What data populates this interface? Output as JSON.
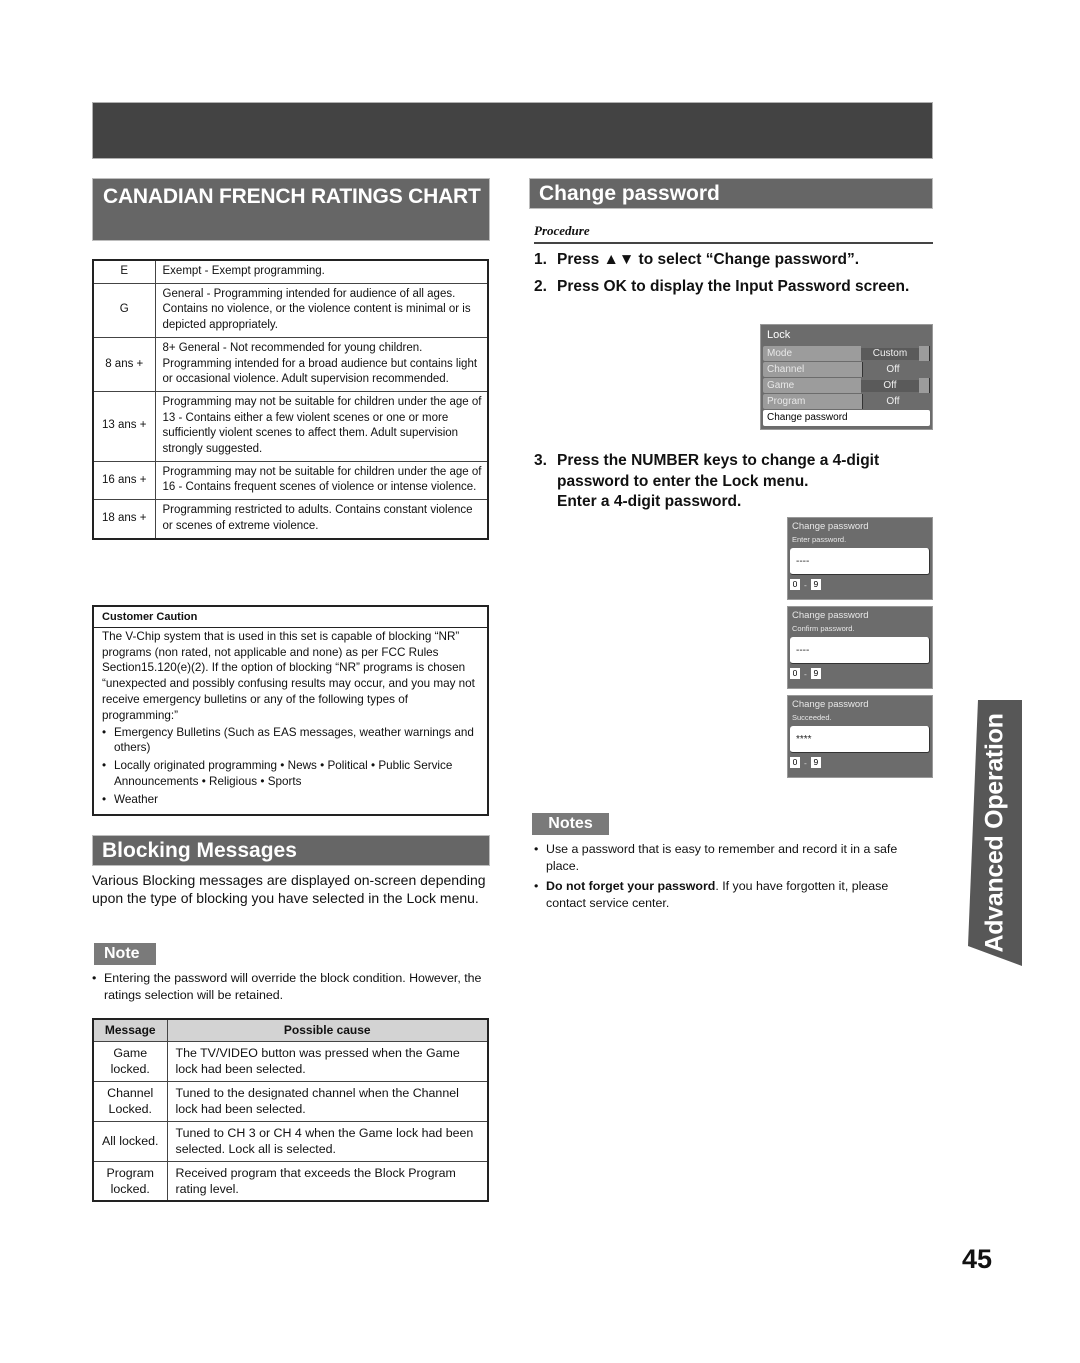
{
  "page_number": "45",
  "side_tab": {
    "label": "Advanced Operation"
  },
  "left": {
    "canadian_header": "CANADIAN FRENCH RATINGS CHART",
    "ratings": [
      {
        "code": "E",
        "description": "Exempt - Exempt programming."
      },
      {
        "code": "G",
        "description": "General - Programming intended for audience of all ages. Contains no violence, or the violence content is minimal or is depicted appropriately."
      },
      {
        "code": "8 ans +",
        "description": "8+ General - Not recommended for young children. Programming intended for a broad audience but contains light or occasional violence. Adult supervision recommended."
      },
      {
        "code": "13 ans +",
        "description": "Programming may not be suitable for children under the age of 13 - Contains either a few violent scenes or one or more sufficiently violent scenes to affect them. Adult supervision strongly suggested."
      },
      {
        "code": "16 ans +",
        "description": "Programming may not be suitable for children under the age of 16 - Contains frequent scenes of violence or intense violence."
      },
      {
        "code": "18 ans +",
        "description": "Programming restricted to adults. Contains constant violence or scenes of extreme violence."
      }
    ],
    "customer_caution": {
      "title": "Customer Caution",
      "body": "The V-Chip system that is used in this set is capable of blocking “NR” programs (non rated, not applicable and none) as per FCC Rules Section15.120(e)(2). If the option of blocking “NR” programs is chosen “unexpected and possibly confusing results may occur, and you may not receive emergency bulletins or any of the following types of programming:”",
      "bullets": [
        "Emergency Bulletins (Such as EAS messages, weather warnings and others)",
        "Locally originated programming • News • Political • Public Service Announcements • Religious • Sports",
        "Weather"
      ]
    },
    "blocking_header": "Blocking Messages",
    "blocking_intro": "Various Blocking messages are displayed on-screen depending upon the type of blocking you have selected in the Lock menu.",
    "note_label": "Note",
    "note_items": [
      "Entering the password will override the block condition. However, the ratings selection will be retained."
    ],
    "messages_table": {
      "headers": [
        "Message",
        "Possible cause"
      ],
      "rows": [
        {
          "message": "Game locked.",
          "cause": "The TV/VIDEO button was pressed when the Game lock had been selected."
        },
        {
          "message": "Channel Locked.",
          "cause": "Tuned to the designated channel when the Channel lock had been selected."
        },
        {
          "message": "All locked.",
          "cause": "Tuned to CH 3 or CH 4 when the Game lock had been selected. Lock all is selected."
        },
        {
          "message": "Program locked.",
          "cause": "Received program that exceeds the Block Program rating level."
        }
      ]
    }
  },
  "right": {
    "change_header": "Change password",
    "procedure_label": "Procedure",
    "steps": [
      {
        "num": "1.",
        "text": "Press ▲▼ to select “Change password”."
      },
      {
        "num": "2.",
        "text": "Press OK to display the Input Password screen."
      },
      {
        "num": "3.",
        "text": "Press the NUMBER keys to change a 4-digit password to enter the Lock menu.",
        "sub": "Enter a 4-digit password."
      }
    ],
    "lock_menu": {
      "title": "Lock",
      "rows": [
        {
          "label": "Mode",
          "value": "Custom"
        },
        {
          "label": "Channel",
          "value": "Off"
        },
        {
          "label": "Game",
          "value": "Off"
        },
        {
          "label": "Program",
          "value": "Off"
        }
      ],
      "selected": "Change password"
    },
    "pw_screens": [
      {
        "title": "Change password",
        "prompt": "Enter password.",
        "field": "----",
        "range_from": "0",
        "range_sep": "-",
        "range_to": "9"
      },
      {
        "title": "Change password",
        "prompt": "Confirm password.",
        "field": "----",
        "range_from": "0",
        "range_sep": "-",
        "range_to": "9"
      },
      {
        "title": "Change password",
        "prompt": "Succeeded.",
        "field": "****",
        "range_from": "0",
        "range_sep": "-",
        "range_to": "9"
      }
    ],
    "notes_label": "Notes",
    "notes": [
      {
        "bold": "",
        "text": "Use a password that is easy to remember and record it in a safe place."
      },
      {
        "bold": "Do not forget your password",
        "text": ". If you have forgotten it, please contact service center."
      }
    ],
    "bullet_char": "•"
  }
}
